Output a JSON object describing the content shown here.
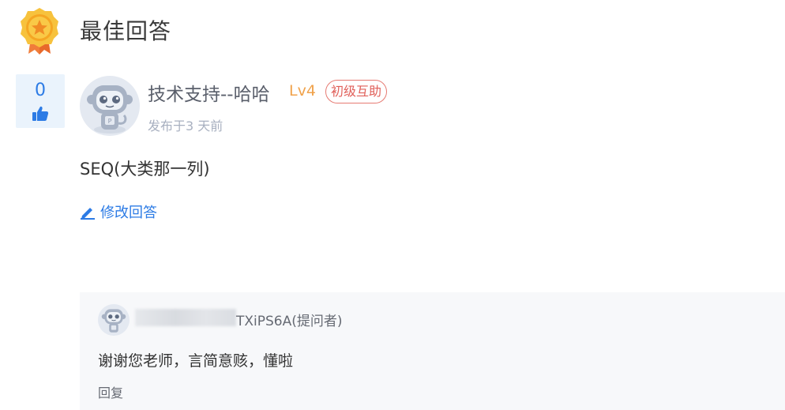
{
  "header": {
    "title": "最佳回答",
    "medal_color": "#f5b82e",
    "ribbon_color": "#f07d3a"
  },
  "vote": {
    "count": "0",
    "accent": "#2c7be5"
  },
  "answer": {
    "author_name": "技术支持--哈哈",
    "level": "Lv4",
    "badge": "初级互助",
    "post_time": "发布于3 天前",
    "content": "SEQ(大类那一列)",
    "edit_label": "修改回答"
  },
  "comment": {
    "commenter_visible_name": "TXiPS6A(提问者)",
    "text": "谢谢您老师，言简意赅，懂啦",
    "reply_label": "回复"
  },
  "icons": {
    "medal": "medal-icon",
    "thumb": "thumbs-up-icon",
    "edit": "pencil-icon",
    "avatar": "monkey-avatar"
  }
}
